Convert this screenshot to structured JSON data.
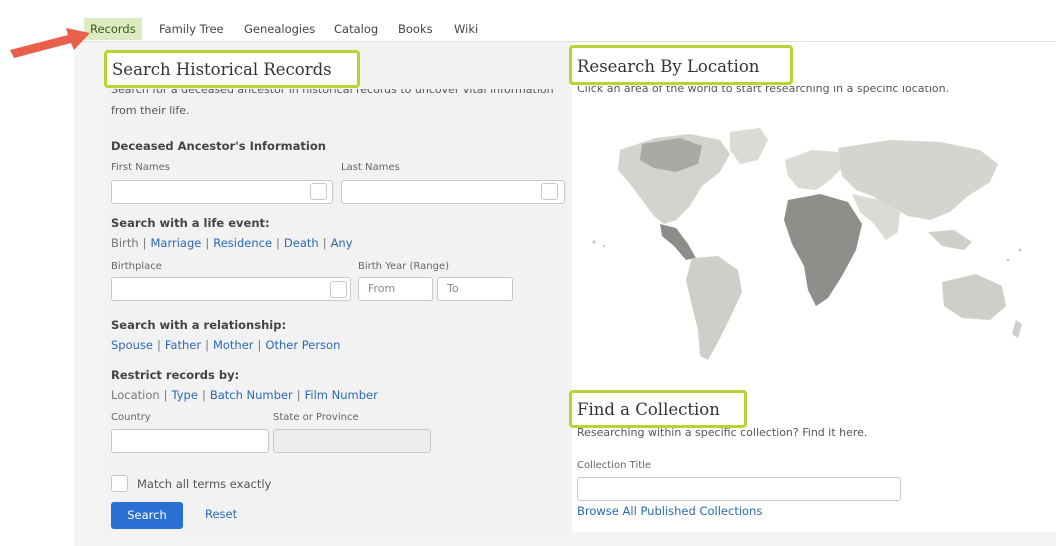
{
  "nav": {
    "items": [
      "Records",
      "Family Tree",
      "Genealogies",
      "Catalog",
      "Books",
      "Wiki"
    ]
  },
  "search": {
    "title": "Search Historical Records",
    "description_line1": "Search for a deceased ancestor in historical records to uncover vital information",
    "description_line2": "from their life.",
    "ancestor_section": "Deceased Ancestor's Information",
    "first_names_label": "First Names",
    "last_names_label": "Last Names",
    "life_event_section": "Search with a life event:",
    "life_events": [
      "Birth",
      "Marriage",
      "Residence",
      "Death",
      "Any"
    ],
    "birthplace_label": "Birthplace",
    "birth_year_label": "Birth Year (Range)",
    "from_placeholder": "From",
    "to_placeholder": "To",
    "relationship_section": "Search with a relationship:",
    "relationships": [
      "Spouse",
      "Father",
      "Mother",
      "Other Person"
    ],
    "restrict_section": "Restrict records by:",
    "restrict_options": [
      "Location",
      "Type",
      "Batch Number",
      "Film Number"
    ],
    "country_label": "Country",
    "state_label": "State or Province",
    "match_exact_label": "Match all terms exactly",
    "search_button": "Search",
    "reset_button": "Reset"
  },
  "location": {
    "title": "Research By Location",
    "description": "Click an area of the world to start researching in a specific location."
  },
  "collection": {
    "title": "Find a Collection",
    "description": "Researching within a specific collection? Find it here.",
    "title_label": "Collection Title",
    "browse_link": "Browse All Published Collections"
  },
  "colors": {
    "highlight": "#b7d334",
    "active_tab": "#dcecc0",
    "link": "#2a6ab5",
    "primary_button": "#2a6fd4",
    "arrow": "#e8604c"
  }
}
